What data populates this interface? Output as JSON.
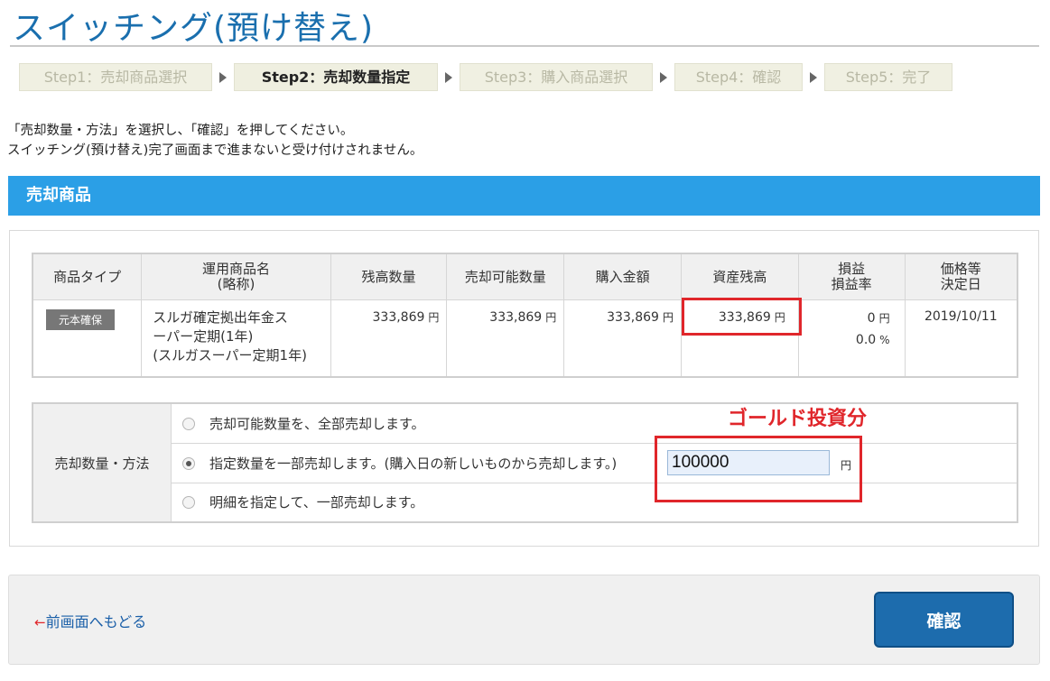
{
  "page": {
    "title": "スイッチング(預け替え)",
    "instructions": [
      "「売却数量・方法」を選択し、「確認」を押してください。",
      "スイッチング(預け替え)完了画面まで進まないと受け付けされません。"
    ]
  },
  "steps": [
    {
      "label": "Step1：売却商品選択",
      "active": false
    },
    {
      "label": "Step2：売却数量指定",
      "active": true
    },
    {
      "label": "Step3：購入商品選択",
      "active": false
    },
    {
      "label": "Step4：確認",
      "active": false
    },
    {
      "label": "Step5：完了",
      "active": false
    }
  ],
  "section": {
    "title": "売却商品"
  },
  "table": {
    "headers": {
      "type": "商品タイプ",
      "name_line1": "運用商品名",
      "name_line2": "(略称)",
      "balance_qty": "残高数量",
      "sellable_qty": "売却可能数量",
      "purchase_amount": "購入金額",
      "asset_balance": "資産残高",
      "pl_line1": "損益",
      "pl_line2": "損益率",
      "date_line1": "価格等",
      "date_line2": "決定日"
    },
    "row": {
      "type_badge": "元本確保",
      "name_line1": "スルガ確定拠出年金ス",
      "name_line2": "ーパー定期(1年)",
      "name_line3": "(スルガスーパー定期1年)",
      "balance_qty": "333,869",
      "sellable_qty": "333,869",
      "purchase_amount": "333,869",
      "asset_balance": "333,869",
      "pl": "0",
      "pl_rate": "0.0",
      "pl_rate_unit": "%",
      "date": "2019/10/11"
    },
    "yen": "円"
  },
  "method": {
    "label": "売却数量・方法",
    "options": [
      {
        "label": "売却可能数量を、全部売却します。",
        "checked": false
      },
      {
        "label": "指定数量を一部売却します。(購入日の新しいものから売却します。)",
        "checked": true
      },
      {
        "label": "明細を指定して、一部売却します。",
        "checked": false
      }
    ],
    "amount_value": "100000",
    "amount_unit": "円"
  },
  "annotation": {
    "text": "ゴールド投資分",
    "color": "#e0262b"
  },
  "footer": {
    "back_arrow": "←",
    "back_label": "前画面へもどる",
    "confirm_label": "確認"
  },
  "colors": {
    "title": "#1a6fae",
    "section_header": "#2b9fe6",
    "confirm_button": "#1d6cad",
    "highlight": "#e0262b"
  }
}
